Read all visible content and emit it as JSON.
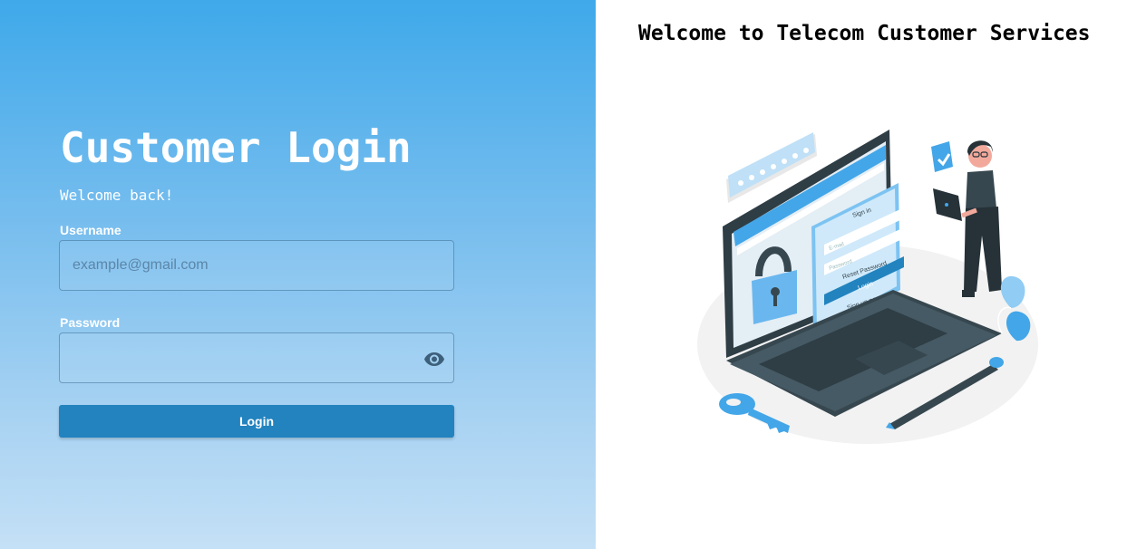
{
  "login": {
    "title": "Customer Login",
    "subtitle": "Welcome back!",
    "username_label": "Username",
    "username_placeholder": "example@gmail.com",
    "username_value": "",
    "password_label": "Password",
    "password_value": "",
    "show_password_icon": "eye-icon",
    "login_button_label": "Login"
  },
  "right": {
    "heading": "Welcome to Telecom Customer Services",
    "illustration": {
      "signin_title": "Sign in",
      "email_placeholder": "E-mail",
      "password_placeholder": "Password",
      "reset_password_label": "Reset Password",
      "login_label": "Login",
      "signup_label": "Sign up now"
    }
  },
  "colors": {
    "panel_gradient_top": "#3fa9ea",
    "panel_gradient_bottom": "#c4e0f6",
    "button": "#2283bf",
    "accent": "#43a6e8",
    "laptop_dark": "#37474f"
  }
}
